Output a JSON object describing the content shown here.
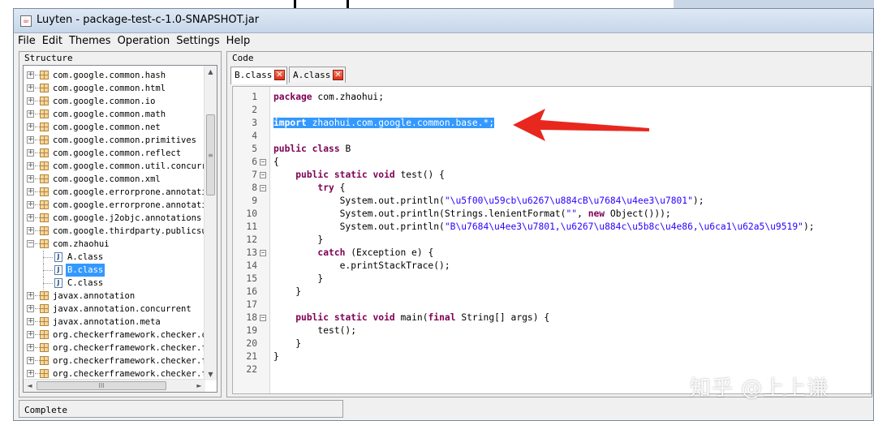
{
  "window": {
    "title": "Luyten - package-test-c-1.0-SNAPSHOT.jar"
  },
  "menu": [
    "File",
    "Edit",
    "Themes",
    "Operation",
    "Settings",
    "Help"
  ],
  "structure": {
    "label": "Structure",
    "items": [
      {
        "label": "com.google.common.hash",
        "type": "package"
      },
      {
        "label": "com.google.common.html",
        "type": "package"
      },
      {
        "label": "com.google.common.io",
        "type": "package"
      },
      {
        "label": "com.google.common.math",
        "type": "package"
      },
      {
        "label": "com.google.common.net",
        "type": "package"
      },
      {
        "label": "com.google.common.primitives",
        "type": "package"
      },
      {
        "label": "com.google.common.reflect",
        "type": "package"
      },
      {
        "label": "com.google.common.util.concurr",
        "type": "package"
      },
      {
        "label": "com.google.common.xml",
        "type": "package"
      },
      {
        "label": "com.google.errorprone.annotati",
        "type": "package"
      },
      {
        "label": "com.google.errorprone.annotati",
        "type": "package"
      },
      {
        "label": "com.google.j2objc.annotations",
        "type": "package"
      },
      {
        "label": "com.google.thirdparty.publicsu",
        "type": "package"
      },
      {
        "label": "com.zhaohui",
        "type": "package",
        "expanded": true
      },
      {
        "label": "A.class",
        "type": "class"
      },
      {
        "label": "B.class",
        "type": "class",
        "selected": true
      },
      {
        "label": "C.class",
        "type": "class"
      },
      {
        "label": "javax.annotation",
        "type": "package"
      },
      {
        "label": "javax.annotation.concurrent",
        "type": "package"
      },
      {
        "label": "javax.annotation.meta",
        "type": "package"
      },
      {
        "label": "org.checkerframework.checker.c",
        "type": "package"
      },
      {
        "label": "org.checkerframework.checker.f",
        "type": "package"
      },
      {
        "label": "org.checkerframework.checker.f",
        "type": "package"
      },
      {
        "label": "org.checkerframework.checker.f",
        "type": "package"
      }
    ],
    "hscroll_thumb_glyph": "III",
    "vscroll_thumb_glyph": "≡"
  },
  "code": {
    "label": "Code",
    "tabs": [
      {
        "label": "B.class",
        "active": true
      },
      {
        "label": "A.class",
        "active": false
      }
    ],
    "close_glyph": "✕",
    "lines": [
      "package com.zhaohui;",
      "",
      "import zhaohui.com.google.common.base.*;",
      "",
      "public class B",
      "{",
      "    public static void test() {",
      "        try {",
      "            System.out.println(\"\\u5f00\\u59cb\\u6267\\u884cB\\u7684\\u4ee3\\u7801\");",
      "            System.out.println(Strings.lenientFormat(\"\", new Object()));",
      "            System.out.println(\"B\\u7684\\u4ee3\\u7801,\\u6267\\u884c\\u5b8c\\u4e86,\\u6ca1\\u62a5\\u9519\");",
      "        }",
      "        catch (Exception e) {",
      "            e.printStackTrace();",
      "        }",
      "    }",
      "",
      "    public static void main(final String[] args) {",
      "        test();",
      "    }",
      "}",
      ""
    ],
    "fold_lines": [
      6,
      7,
      8,
      13,
      18
    ],
    "selected_line": 3
  },
  "status": {
    "text": "Complete"
  },
  "watermark": "知乎 @上上谦",
  "colors": {
    "annotation_arrow": "#e8281e",
    "selection": "#3399ff"
  }
}
